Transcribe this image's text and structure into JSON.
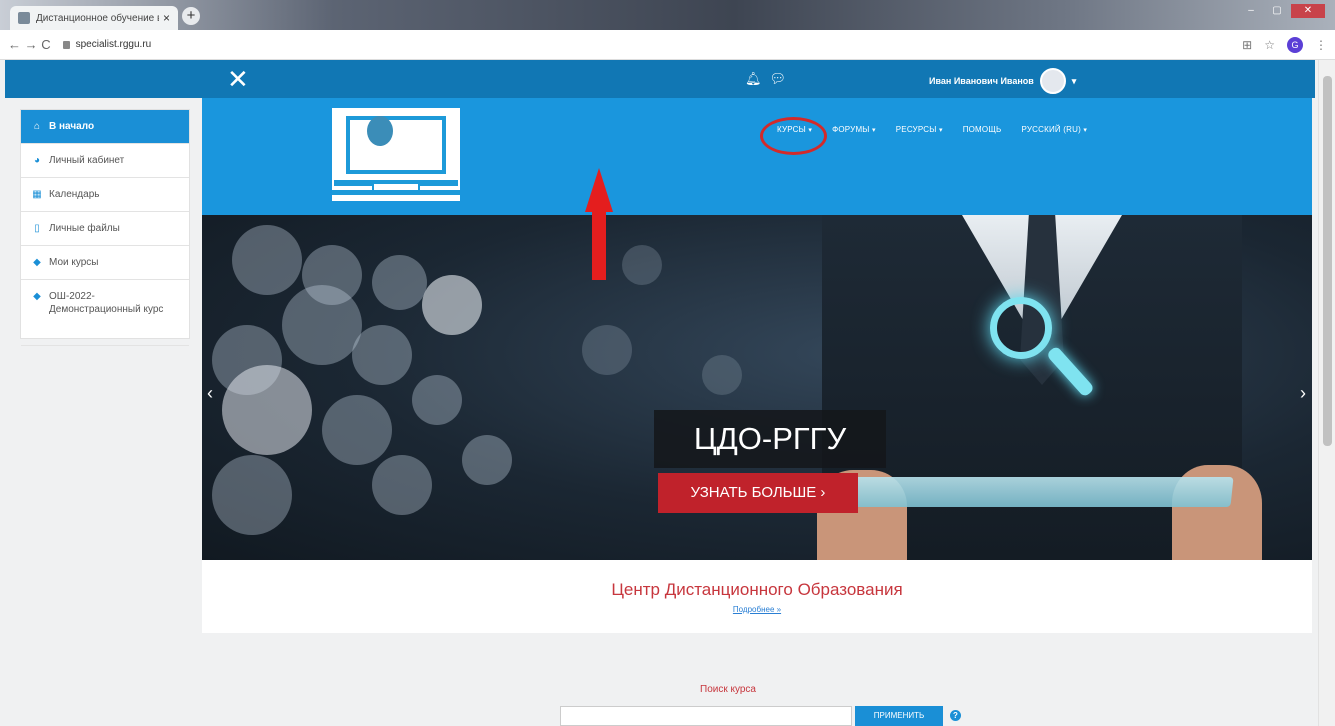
{
  "browser": {
    "tab_title": "Дистанционное обучение в РГГ",
    "tab_close": "×",
    "new_tab": "+",
    "nav": "← → C",
    "url": "specialist.rggu.ru"
  },
  "site": {
    "user_name": "Иван Иванович Иванов",
    "close_symbol": "✕",
    "notifications_icon": "bell-icon",
    "messages_icon": "chat-icon"
  },
  "drawer": {
    "items": [
      {
        "label": "В начало",
        "icon": "home-icon"
      },
      {
        "label": "Личный кабинет",
        "icon": "dashboard-icon"
      },
      {
        "label": "Календарь",
        "icon": "calendar-icon"
      },
      {
        "label": "Личные файлы",
        "icon": "file-icon"
      },
      {
        "label": "Мои курсы",
        "icon": "graduation-cap-icon"
      },
      {
        "label": "ОШ-2022-Демонстрационный курс",
        "icon": "graduation-cap-icon"
      }
    ]
  },
  "menu": {
    "items": [
      {
        "label": "КУРСЫ"
      },
      {
        "label": "ФОРУМЫ"
      },
      {
        "label": "РЕСУРСЫ"
      },
      {
        "label": "ПОМОЩЬ"
      },
      {
        "label": "РУССКИЙ (RU)"
      }
    ]
  },
  "hero": {
    "title": "ЦДО-РГГУ",
    "button": "УЗНАТЬ БОЛЬШЕ ›",
    "prev": "‹",
    "next": "›"
  },
  "content": {
    "title": "Центр Дистанционного Образования",
    "more_link": "Подробнее »",
    "search_label": "Поиск курса",
    "search_button": "ПРИМЕНИТЬ",
    "help": "?"
  },
  "colors": {
    "navbar": "#1177b4",
    "header": "#1a96dd",
    "accent_red": "#c0222b",
    "annotation_red": "#e41e1e"
  }
}
